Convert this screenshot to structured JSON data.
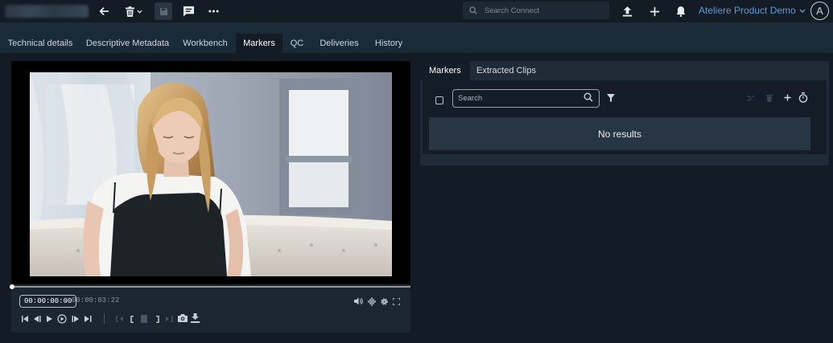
{
  "header": {
    "search_placeholder": "Search Connect",
    "account_name": "Ateliere Product Demo",
    "avatar_initial": "A"
  },
  "tabs": [
    {
      "label": "Technical details"
    },
    {
      "label": "Descriptive Metadata"
    },
    {
      "label": "Workbench"
    },
    {
      "label": "Markers",
      "active": true
    },
    {
      "label": "QC"
    },
    {
      "label": "Deliveries"
    },
    {
      "label": "History"
    }
  ],
  "player": {
    "current_time": "00:00:00:00",
    "separator": "/",
    "duration": "00:00:03:22",
    "progress": 0
  },
  "markers_panel": {
    "tabs": [
      {
        "label": "Markers",
        "active": true
      },
      {
        "label": "Extracted Clips"
      }
    ],
    "search_placeholder": "Search",
    "empty_message": "No results"
  },
  "colors": {
    "background": "#131c25",
    "tab_strip": "#1b2a37",
    "accent": "#5b9bdb",
    "panel": "#1f2b37"
  }
}
